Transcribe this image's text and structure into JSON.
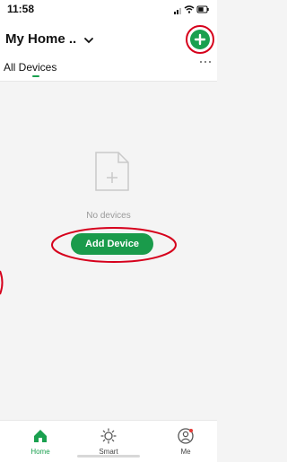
{
  "status_bar": {
    "time": "11:58"
  },
  "header": {
    "home_title": "My Home .."
  },
  "tabs": {
    "all_devices": "All Devices"
  },
  "empty_state": {
    "text": "No devices",
    "button_label": "Add Device"
  },
  "bottom_nav": [
    {
      "label": "Home"
    },
    {
      "label": "Smart"
    },
    {
      "label": "Me"
    }
  ],
  "colors": {
    "accent": "#1aa04f",
    "highlight": "#d6001c"
  }
}
